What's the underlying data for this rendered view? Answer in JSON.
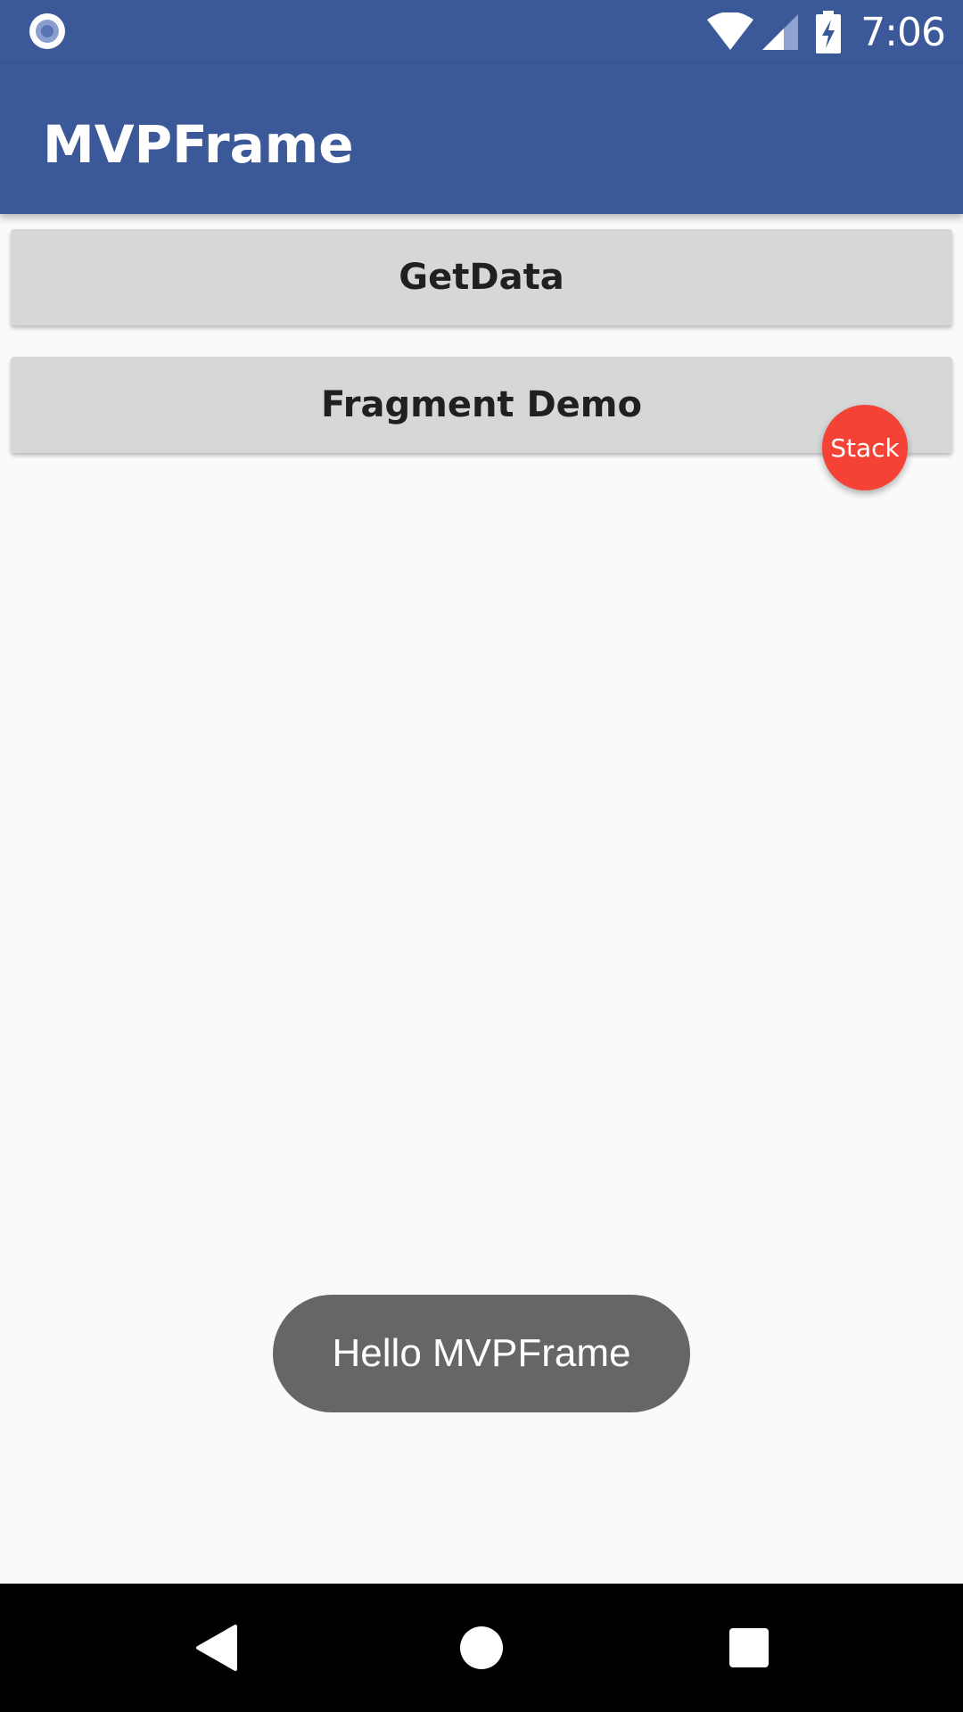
{
  "status_bar": {
    "time": "7:06",
    "background_color": "#3b5998",
    "icons": [
      "notification-dot-icon",
      "wifi-icon",
      "signal-icon",
      "battery-charging-icon"
    ]
  },
  "app_bar": {
    "title": "MVPFrame",
    "background_color": "#3b5998"
  },
  "buttons": {
    "get_data": "GetData",
    "fragment_demo": "Fragment Demo"
  },
  "fab": {
    "label": "Stack",
    "color": "#f44336"
  },
  "toast": {
    "message": "Hello MVPFrame"
  },
  "nav_bar": {
    "icons": [
      "back-icon",
      "home-icon",
      "recents-icon"
    ]
  }
}
